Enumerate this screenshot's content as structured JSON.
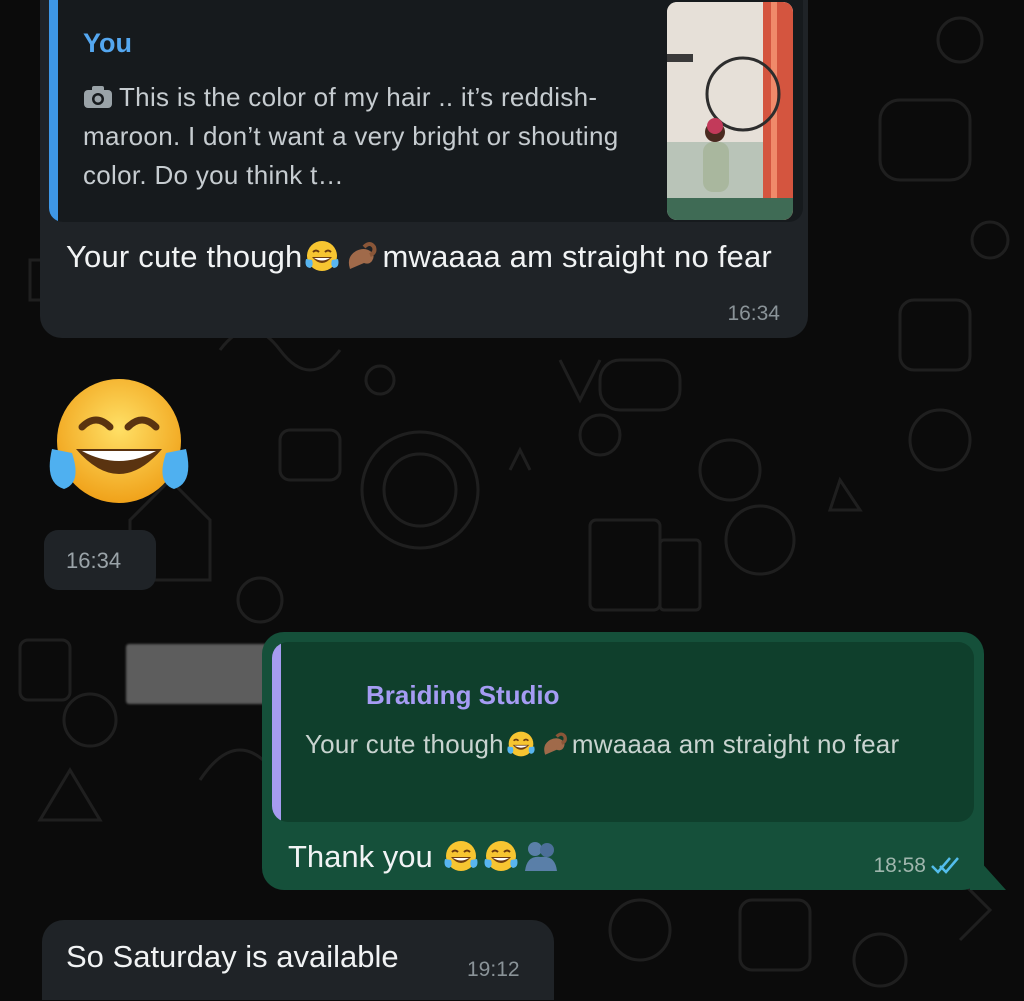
{
  "messages": [
    {
      "direction": "incoming",
      "reply": {
        "author": "You",
        "text": "This is the color of my hair .. it’s reddish-maroon. I don’t want a very bright or shouting color. Do you think t…",
        "icon": "camera-icon",
        "author_color": "#54a7f0"
      },
      "text_before": "Your cute though",
      "text_after": "mwaaaa am straight no fear",
      "time": "16:34"
    },
    {
      "direction": "incoming",
      "emoji": "face-with-tears-of-joy-icon",
      "time": "16:34"
    },
    {
      "direction": "outgoing",
      "reply": {
        "author": "Braiding Studio",
        "text_before": "Your cute though",
        "text_after": "mwaaaa am straight no fear",
        "author_color": "#a59cf3"
      },
      "text": "Thank you",
      "time": "18:58",
      "status": "read"
    },
    {
      "direction": "incoming",
      "text": "So Saturday is available",
      "time": "19:12"
    }
  ],
  "colors": {
    "background": "#0b0b0b",
    "incoming_bubble": "#1f2327",
    "outgoing_bubble": "#15503a",
    "read_ticks": "#53bdeb"
  }
}
